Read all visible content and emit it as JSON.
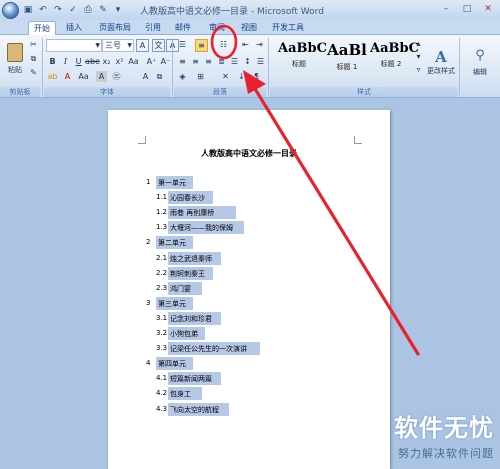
{
  "window": {
    "title": "人教版高中语文必修一目录 - Microsoft Word",
    "quick_access": [
      "save-icon",
      "undo-icon",
      "redo-icon",
      "spell-icon",
      "print-icon",
      "paint-icon",
      "dropdown-icon"
    ],
    "controls": {
      "minimize": "–",
      "maximize": "□",
      "close": "✕"
    }
  },
  "tabs": [
    "开始",
    "插入",
    "页面布局",
    "引用",
    "邮件",
    "审阅",
    "视图",
    "开发工具"
  ],
  "ribbon": {
    "clipboard": {
      "paste_label": "粘贴",
      "group_label": "剪贴板"
    },
    "font": {
      "font_name": "",
      "font_size": "三号",
      "group_label": "字体",
      "wen": "文"
    },
    "paragraph": {
      "group_label": "段落"
    },
    "styles": {
      "group_label": "样式",
      "items": [
        {
          "sample": "AaBbC",
          "name": "标题"
        },
        {
          "sample": "AaBl",
          "name": "标题 1"
        },
        {
          "sample": "AaBbC",
          "name": "标题 2"
        }
      ],
      "change_styles_label": "更改样式"
    },
    "editing": {
      "label": "编辑"
    }
  },
  "document": {
    "title": "人教版高中语文必修一目录",
    "toc": [
      {
        "num": "1",
        "text": "第一单元",
        "level": 1
      },
      {
        "num": "1.1",
        "text": "沁园春长沙",
        "level": 2
      },
      {
        "num": "1.2",
        "text": "雨巷  再别康桥",
        "level": 2
      },
      {
        "num": "1.3",
        "text": "大堰河——我的保姆",
        "level": 2
      },
      {
        "num": "2",
        "text": "第二单元",
        "level": 1
      },
      {
        "num": "2.1",
        "text": "烛之武退秦师",
        "level": 2
      },
      {
        "num": "2.2",
        "text": "荆轲刺秦王",
        "level": 2
      },
      {
        "num": "2.3",
        "text": "鸿门宴",
        "level": 2
      },
      {
        "num": "3",
        "text": "第三单元",
        "level": 1
      },
      {
        "num": "3.1",
        "text": "记念刘和珍君",
        "level": 2
      },
      {
        "num": "3.2",
        "text": "小狗包弟",
        "level": 2
      },
      {
        "num": "3.3",
        "text": "记梁任公先生的一次演讲",
        "level": 2
      },
      {
        "num": "4",
        "text": "第四单元",
        "level": 1
      },
      {
        "num": "4.1",
        "text": "短篇新闻两篇",
        "level": 2
      },
      {
        "num": "4.2",
        "text": "包身工",
        "level": 2
      },
      {
        "num": "4.3",
        "text": "飞向太空的航程",
        "level": 2
      }
    ]
  },
  "annotation": {
    "color": "#e8212a"
  },
  "watermark": {
    "main": "软件无忧",
    "sub": "努力解决软件问题"
  }
}
